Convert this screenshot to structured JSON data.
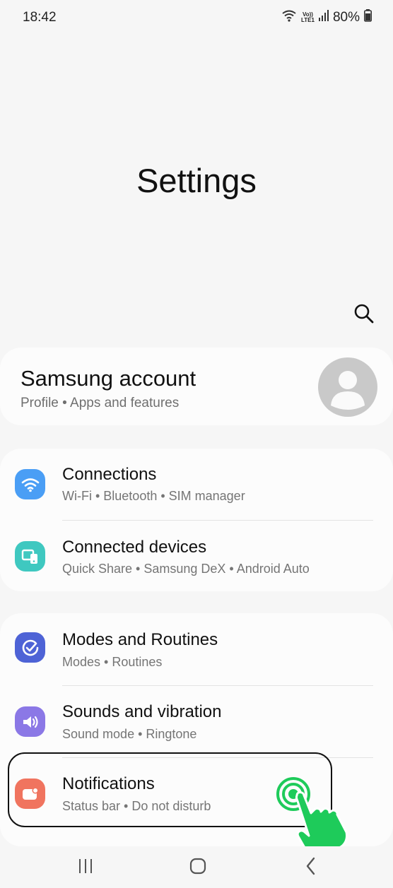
{
  "status_bar": {
    "time": "18:42",
    "volte_top": "Vo))",
    "volte_bottom": "LTE1",
    "battery": "80%",
    "icons": [
      "wifi-icon",
      "volte-icon",
      "signal-icon",
      "battery-icon"
    ]
  },
  "header": {
    "title": "Settings",
    "search_icon": "search-icon"
  },
  "account": {
    "title": "Samsung account",
    "subtitle": "Profile  •  Apps and features",
    "avatar_icon": "person-icon"
  },
  "groups": [
    {
      "items": [
        {
          "title": "Connections",
          "subtitle": "Wi-Fi  •  Bluetooth  •  SIM manager",
          "icon": "wifi-icon",
          "icon_color": "#4a9ef5"
        },
        {
          "title": "Connected devices",
          "subtitle": "Quick Share  •  Samsung DeX  •  Android Auto",
          "icon": "connected-devices-icon",
          "icon_color": "#3fc8c0"
        }
      ]
    },
    {
      "items": [
        {
          "title": "Modes and Routines",
          "subtitle": "Modes  •  Routines",
          "icon": "modes-check-icon",
          "icon_color": "#4e63d6"
        },
        {
          "title": "Sounds and vibration",
          "subtitle": "Sound mode  •  Ringtone",
          "icon": "speaker-icon",
          "icon_color": "#8b78e6"
        },
        {
          "title": "Notifications",
          "subtitle": "Status bar  •  Do not disturb",
          "icon": "notification-icon",
          "icon_color": "#f0745f"
        }
      ]
    }
  ],
  "annotation": {
    "highlight_target": "Notifications",
    "tap_icon": "tap-hand-icon",
    "tap_color": "#1ecb5a"
  },
  "nav_bar": {
    "recents_icon": "recents-icon",
    "home_icon": "home-icon",
    "back_icon": "back-icon"
  }
}
